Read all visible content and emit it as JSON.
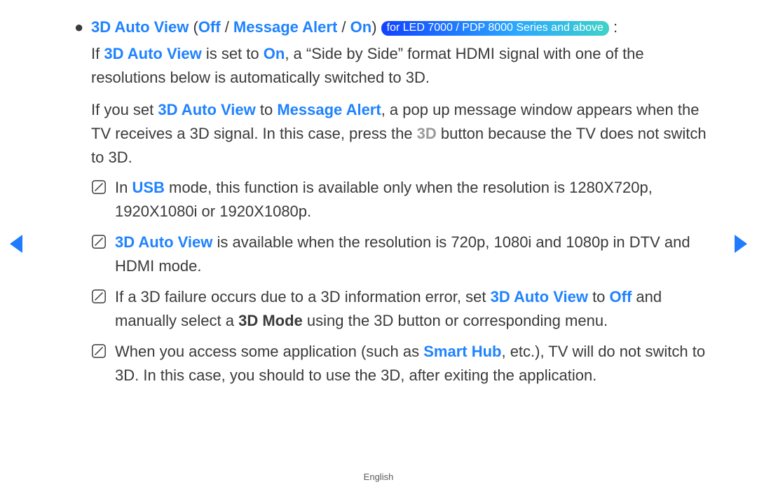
{
  "header": {
    "feature": "3D Auto View",
    "opt_off": "Off",
    "opt_msg": "Message Alert",
    "opt_on": "On",
    "open_paren": " (",
    "sep": " / ",
    "close_paren": ") ",
    "badge": "for LED 7000 / PDP 8000 Series and above",
    "colon": " :"
  },
  "p1": {
    "a": "If ",
    "b": "3D Auto View",
    "c": " is set to ",
    "d": "On",
    "e": ", a “Side by Side” format HDMI signal with one of the resolutions below is automatically switched to 3D."
  },
  "p2": {
    "a": "If you set ",
    "b": "3D Auto View",
    "c": " to ",
    "d": "Message Alert",
    "e": ", a pop up message window appears when the TV receives a 3D signal. In this case, press the ",
    "f": "3D",
    "g": " button because the TV does not switch to 3D."
  },
  "notes": {
    "n1": {
      "a": "In ",
      "b": "USB",
      "c": " mode, this function is available only when the resolution is 1280X720p, 1920X1080i or 1920X1080p."
    },
    "n2": {
      "a": "3D Auto View",
      "b": " is available when the resolution is 720p, 1080i and 1080p in DTV and HDMI mode."
    },
    "n3": {
      "a": "If a 3D failure occurs due to a 3D information error, set ",
      "b": "3D Auto View",
      "c": " to ",
      "d": "Off",
      "e": " and manually select a ",
      "f": "3D Mode",
      "g": " using the 3D button or corresponding menu."
    },
    "n4": {
      "a": "When you access some application (such as ",
      "b": "Smart Hub",
      "c": ", etc.), TV will do not switch to 3D. In this case, you should to use the 3D, after exiting the application."
    }
  },
  "bullet_char": "●",
  "footer": "English"
}
